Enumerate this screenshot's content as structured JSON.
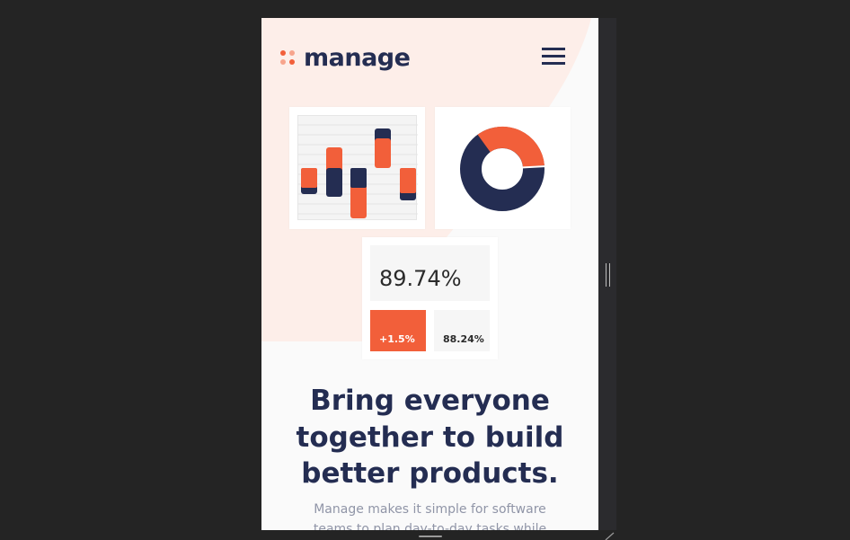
{
  "header": {
    "logo_text": "manage",
    "menu_icon": "hamburger-icon"
  },
  "illustration": {
    "percent_main": "89.74%",
    "percent_change": "+1.5%",
    "percent_secondary": "88.24%"
  },
  "hero": {
    "title_line1": "Bring everyone",
    "title_line2": "together to build",
    "title_line3": "better products.",
    "description": "Manage makes it simple for software teams to plan day-to-day tasks while"
  },
  "colors": {
    "brand_orange": "#f25f3a",
    "brand_navy": "#242d52",
    "background": "#fafafa",
    "accent_pale": "#fdeee9"
  }
}
